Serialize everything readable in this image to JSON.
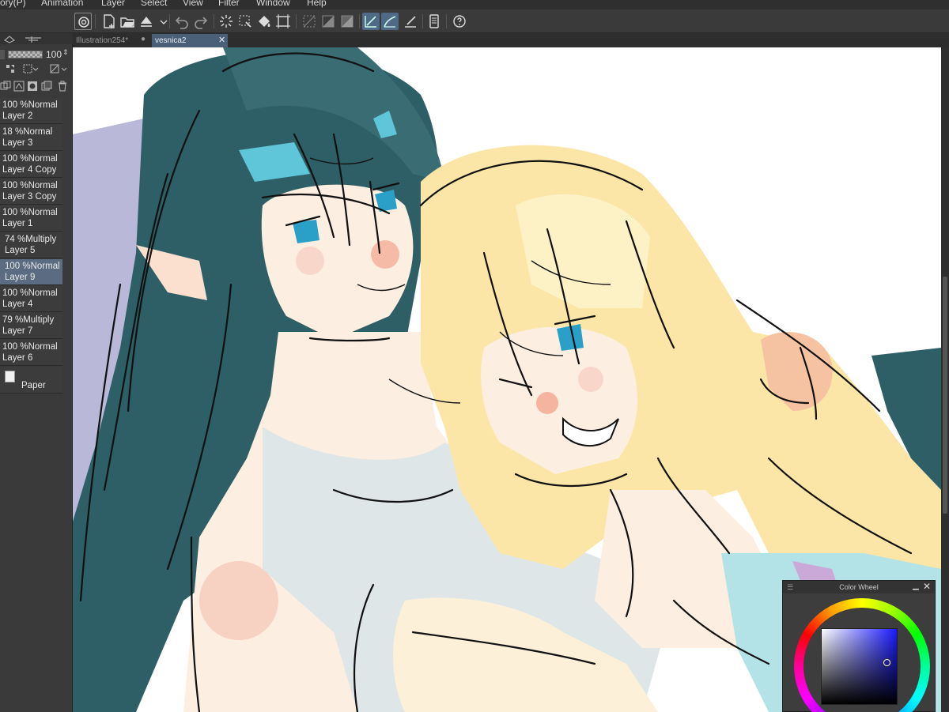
{
  "menu": {
    "items": [
      "ory(P)",
      "Animation",
      "Layer",
      "Select",
      "View",
      "Filter",
      "Window",
      "Help"
    ]
  },
  "toolbar": {
    "icons": [
      "app-logo-icon",
      "new-file-icon",
      "open-file-icon",
      "save-icon",
      "undo-icon",
      "redo-icon",
      "selection-clear-icon",
      "selection-transform-icon",
      "fill-icon",
      "crop-icon",
      "snap-off-icon",
      "snap-grid-icon",
      "ruler-snap-icon",
      "ruler-curve-icon",
      "ruler-line-icon",
      "smartphone-icon",
      "help-icon"
    ]
  },
  "tabs": [
    {
      "label": "Illustration254*",
      "active": false
    },
    {
      "label": "vesnica2",
      "active": true
    }
  ],
  "layer_panel": {
    "opacity_value": "100",
    "layers": [
      {
        "opacity_mode": "100 %Normal",
        "name": "Layer 2",
        "selected": false
      },
      {
        "opacity_mode": "18 %Normal",
        "name": "Layer 3",
        "selected": false
      },
      {
        "opacity_mode": "100 %Normal",
        "name": "Layer 4 Copy",
        "selected": false
      },
      {
        "opacity_mode": "100 %Normal",
        "name": "Layer 3 Copy",
        "selected": false
      },
      {
        "opacity_mode": "100 %Normal",
        "name": "Layer 1",
        "selected": false
      },
      {
        "opacity_mode": "74 %Multiply",
        "name": "Layer 5",
        "selected": false
      },
      {
        "opacity_mode": "100 %Normal",
        "name": "Layer 9",
        "selected": true
      },
      {
        "opacity_mode": "100 %Normal",
        "name": "Layer 4",
        "selected": false
      },
      {
        "opacity_mode": "79 %Multiply",
        "name": "Layer 7",
        "selected": false
      },
      {
        "opacity_mode": "100 %Normal",
        "name": "Layer 6",
        "selected": false
      }
    ],
    "paper_label": "Paper"
  },
  "color_wheel": {
    "title": "Color Wheel",
    "current_color": "#1919ff"
  },
  "colors": {
    "accent": "#4f6a86",
    "hair_dark": "#2f5f66",
    "hair_blonde": "#fbe6a8",
    "skin": "#fdeee2",
    "shirt": "#dfe6e8"
  }
}
